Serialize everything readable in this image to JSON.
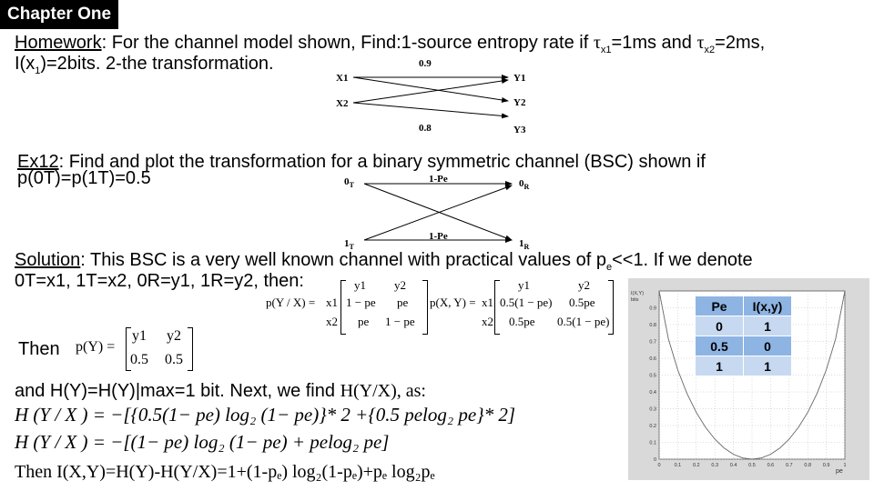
{
  "chapter_label": "Chapter One",
  "homework": {
    "heading": "Homework",
    "line1_rest": ": For the channel model shown,  Find:1-source entropy rate if ",
    "tau": "τ",
    "x1_sub": "x1",
    "eq1": "=1ms and ",
    "x2_sub": "x2",
    "eq2": "=2ms,",
    "line2_a": "I(x",
    "line2_sub": "1",
    "line2_b": ")=2bits. 2-the transformation.",
    "diagram": {
      "x1": "X1",
      "x2": "X2",
      "y1": "Y1",
      "y2": "Y2",
      "y3": "Y3",
      "p_top": "0.9",
      "p_bottom": "0.8"
    }
  },
  "ex12": {
    "heading": "Ex12",
    "line1_rest": ": Find and plot the transformation for a binary symmetric channel (BSC)  shown if",
    "line2": "p(0T)=p(1T)=0.5",
    "diagram": {
      "in0": "0",
      "in0_sub": "T",
      "in1": "1",
      "in1_sub": "T",
      "out0": "0",
      "out0_sub": "R",
      "out1": "1",
      "out1_sub": "R",
      "top_label": "1-Pe",
      "bottom_label": "1-Pe"
    }
  },
  "solution": {
    "heading": "Solution",
    "line1_rest": ": This BSC is a very well known channel with practical values of  p",
    "pe_sub": "e",
    "line1_end": "<<1. If we denote",
    "line2": "0T=x1, 1T=x2, 0R=y1, 1R=y2, then:",
    "pyx_matrix": {
      "label": "p(Y / X) =",
      "cols": [
        "y1",
        "y2"
      ],
      "rows": [
        {
          "name": "x1",
          "cells": [
            "1 − pe",
            "pe"
          ]
        },
        {
          "name": "x2",
          "cells": [
            "pe",
            "1 − pe"
          ]
        }
      ]
    },
    "pxy_matrix": {
      "label": "p(X, Y) =",
      "cols": [
        "y1",
        "y2"
      ],
      "rows": [
        {
          "name": "x1",
          "cells": [
            "0.5(1 − pe)",
            "0.5pe"
          ]
        },
        {
          "name": "x2",
          "cells": [
            "0.5pe",
            "0.5(1 − pe)"
          ]
        }
      ]
    },
    "then_label": "Then",
    "py_matrix": {
      "label": "p(Y) =",
      "cols": [
        "y1",
        "y2"
      ],
      "values": [
        "0.5",
        "0.5"
      ]
    },
    "hy_line_a": "and H(Y)=H(Y)|max=1 bit. Next, we find ",
    "hy_line_b": "H(Y/X), as:",
    "eq_1": "H (Y / X ) = −[{0.5(1− pe) log₂ (1− pe)}* 2 +{0.5 pelog₂ pe}* 2]",
    "eq_2": "H (Y / X ) = −[(1− pe) log₂ (1− pe) + pelog₂ pe]",
    "eq_3": "Then I(X,Y)=H(Y)-H(Y/X)=1+(1-pₑ) log₂(1-pₑ)+pₑ log₂pₑ"
  },
  "chart_data": {
    "type": "line",
    "ylabel": "I(X,Y) bits",
    "xlabel": "pe",
    "xlim": [
      0,
      1
    ],
    "ylim": [
      0,
      1
    ],
    "xticks": [
      "0",
      "0.1",
      "0.2",
      "0.3",
      "0.4",
      "0.5",
      "0.6",
      "0.7",
      "0.8",
      "0.9",
      "1"
    ],
    "yticks": [
      "0",
      "0.1",
      "0.2",
      "0.3",
      "0.4",
      "0.5",
      "0.6",
      "0.7",
      "0.8",
      "0.9"
    ],
    "x": [
      0,
      0.05,
      0.1,
      0.15,
      0.2,
      0.25,
      0.3,
      0.35,
      0.4,
      0.45,
      0.5,
      0.55,
      0.6,
      0.65,
      0.7,
      0.75,
      0.8,
      0.85,
      0.9,
      0.95,
      1
    ],
    "y": [
      1,
      0.714,
      0.531,
      0.39,
      0.278,
      0.189,
      0.119,
      0.066,
      0.029,
      0.007,
      0,
      0.007,
      0.029,
      0.066,
      0.119,
      0.189,
      0.278,
      0.39,
      0.531,
      0.714,
      1
    ],
    "grid": true,
    "table": {
      "headers": [
        "Pe",
        "I(x,y)"
      ],
      "rows": [
        [
          "0",
          "1"
        ],
        [
          "0.5",
          "0"
        ],
        [
          "1",
          "1"
        ]
      ]
    }
  }
}
